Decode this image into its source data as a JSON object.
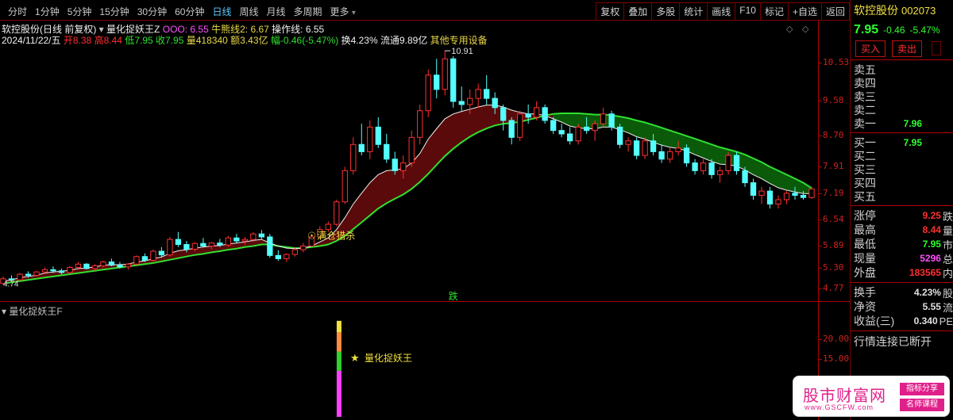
{
  "toolbar": {
    "periods": [
      "分时",
      "1分钟",
      "5分钟",
      "15分钟",
      "30分钟",
      "60分钟",
      "日线",
      "周线",
      "月线",
      "多周期",
      "更多"
    ],
    "active_period": "日线",
    "right_buttons": [
      "复权",
      "叠加",
      "多股",
      "统计",
      "画线",
      "F10",
      "标记",
      "+自选",
      "返回"
    ]
  },
  "chart_info": {
    "title": "软控股份(日线 前复权)",
    "indicator_name": "量化捉妖王Z",
    "ooo_label": "OOO: 6.55",
    "niubai_label": "牛熊线2: 6.67",
    "caozuo_label": "操作线: 6.55",
    "date": "2024/11/22/五",
    "open_label": "开",
    "open": "8.38",
    "high_label": "高",
    "high": "8.44",
    "low_label": "低",
    "low": "7.95",
    "close_label": "收",
    "close": "7.95",
    "vol_label": "量",
    "vol": "418340",
    "amount_label": "额",
    "amount": "3.43亿",
    "range_label": "幅",
    "range": "-0.46(-5.47%)",
    "turnover": "换4.23%",
    "circulation": "流通9.89亿",
    "other": "其他专用设备"
  },
  "y_axis_main": [
    "10.53",
    "9.58",
    "8.70",
    "7.91",
    "7.19",
    "6.54",
    "5.89",
    "5.30",
    "4.77"
  ],
  "y_axis_sub": [
    "20.00",
    "15.00"
  ],
  "annotations": {
    "peak": "10.91",
    "bottom_left": "4.74",
    "signal": "满仓猎杀",
    "die": "跌",
    "sub_signal": "量化捉妖王"
  },
  "sub_title": "量化捉妖王F",
  "chart_data": {
    "type": "candlestick",
    "x_range": [
      0,
      170
    ],
    "y_range": [
      4.5,
      11.1
    ],
    "candles_ohlc": [
      [
        4.74,
        4.86,
        4.72,
        4.82
      ],
      [
        4.82,
        4.88,
        4.78,
        4.8
      ],
      [
        4.8,
        4.92,
        4.78,
        4.9
      ],
      [
        4.9,
        4.95,
        4.84,
        4.88
      ],
      [
        4.88,
        4.96,
        4.86,
        4.94
      ],
      [
        4.94,
        5.02,
        4.9,
        4.98
      ],
      [
        4.98,
        5.04,
        4.92,
        4.96
      ],
      [
        4.96,
        5.0,
        4.9,
        4.93
      ],
      [
        4.93,
        5.05,
        4.91,
        5.02
      ],
      [
        5.02,
        5.12,
        5.0,
        5.08
      ],
      [
        5.08,
        5.1,
        4.98,
        5.0
      ],
      [
        5.0,
        5.08,
        4.96,
        5.05
      ],
      [
        5.05,
        5.14,
        5.02,
        5.12
      ],
      [
        5.12,
        5.18,
        5.04,
        5.06
      ],
      [
        5.06,
        5.12,
        5.0,
        5.03
      ],
      [
        5.03,
        5.1,
        4.98,
        5.08
      ],
      [
        5.08,
        5.24,
        5.06,
        5.22
      ],
      [
        5.22,
        5.28,
        5.12,
        5.15
      ],
      [
        5.15,
        5.35,
        5.13,
        5.32
      ],
      [
        5.32,
        5.4,
        5.2,
        5.25
      ],
      [
        5.25,
        5.6,
        5.22,
        5.55
      ],
      [
        5.55,
        5.7,
        5.4,
        5.45
      ],
      [
        5.45,
        5.52,
        5.3,
        5.36
      ],
      [
        5.36,
        5.5,
        5.32,
        5.47
      ],
      [
        5.47,
        5.58,
        5.4,
        5.42
      ],
      [
        5.42,
        5.5,
        5.36,
        5.48
      ],
      [
        5.48,
        5.56,
        5.4,
        5.44
      ],
      [
        5.44,
        5.62,
        5.4,
        5.58
      ],
      [
        5.58,
        5.66,
        5.48,
        5.52
      ],
      [
        5.52,
        5.6,
        5.44,
        5.55
      ],
      [
        5.55,
        5.7,
        5.5,
        5.66
      ],
      [
        5.66,
        5.74,
        5.55,
        5.6
      ],
      [
        5.6,
        5.66,
        5.2,
        5.24
      ],
      [
        5.24,
        5.34,
        5.14,
        5.18
      ],
      [
        5.18,
        5.28,
        5.12,
        5.26
      ],
      [
        5.26,
        5.4,
        5.22,
        5.35
      ],
      [
        5.35,
        5.48,
        5.3,
        5.42
      ],
      [
        5.42,
        5.66,
        5.4,
        5.6
      ],
      [
        5.6,
        5.82,
        5.56,
        5.75
      ],
      [
        5.75,
        5.92,
        5.7,
        5.86
      ],
      [
        5.86,
        6.4,
        5.82,
        6.35
      ],
      [
        6.35,
        7.2,
        6.3,
        7.1
      ],
      [
        7.1,
        8.0,
        7.0,
        7.8
      ],
      [
        7.8,
        8.4,
        7.5,
        7.6
      ],
      [
        7.6,
        8.5,
        7.4,
        8.3
      ],
      [
        8.3,
        8.6,
        7.7,
        7.8
      ],
      [
        7.8,
        8.1,
        7.3,
        7.4
      ],
      [
        7.4,
        7.6,
        7.0,
        7.1
      ],
      [
        7.1,
        7.5,
        6.9,
        7.3
      ],
      [
        7.3,
        8.2,
        7.2,
        8.0
      ],
      [
        8.0,
        9.0,
        7.8,
        8.8
      ],
      [
        8.8,
        10.2,
        8.6,
        10.0
      ],
      [
        10.0,
        10.6,
        9.2,
        9.5
      ],
      [
        9.5,
        10.91,
        9.3,
        10.6
      ],
      [
        10.6,
        10.7,
        8.9,
        9.1
      ],
      [
        9.1,
        9.6,
        8.8,
        9.0
      ],
      [
        9.0,
        9.5,
        8.7,
        9.2
      ],
      [
        9.2,
        9.7,
        8.9,
        9.5
      ],
      [
        9.5,
        10.0,
        9.0,
        9.2
      ],
      [
        9.2,
        9.4,
        8.7,
        8.9
      ],
      [
        8.9,
        9.0,
        8.2,
        8.5
      ],
      [
        8.5,
        8.6,
        7.8,
        8.0
      ],
      [
        8.0,
        8.8,
        7.9,
        8.7
      ],
      [
        8.7,
        9.0,
        8.4,
        8.6
      ],
      [
        8.6,
        9.1,
        8.5,
        8.9
      ],
      [
        8.9,
        9.0,
        8.4,
        8.5
      ],
      [
        8.5,
        8.6,
        8.1,
        8.2
      ],
      [
        8.2,
        8.4,
        8.0,
        8.1
      ],
      [
        8.1,
        8.3,
        7.8,
        7.9
      ],
      [
        7.9,
        8.4,
        7.8,
        8.3
      ],
      [
        8.3,
        8.6,
        8.1,
        8.2
      ],
      [
        8.2,
        8.5,
        7.9,
        8.4
      ],
      [
        8.4,
        8.9,
        8.3,
        8.7
      ],
      [
        8.7,
        8.8,
        8.2,
        8.3
      ],
      [
        8.3,
        8.4,
        7.7,
        7.8
      ],
      [
        7.8,
        8.0,
        7.6,
        7.9
      ],
      [
        7.9,
        8.0,
        7.4,
        7.5
      ],
      [
        7.5,
        8.0,
        7.4,
        7.9
      ],
      [
        7.9,
        8.1,
        7.5,
        7.6
      ],
      [
        7.6,
        7.8,
        7.3,
        7.4
      ],
      [
        7.4,
        7.7,
        7.3,
        7.6
      ],
      [
        7.6,
        7.9,
        7.5,
        7.7
      ],
      [
        7.7,
        7.8,
        7.2,
        7.3
      ],
      [
        7.3,
        7.4,
        7.0,
        7.1
      ],
      [
        7.1,
        7.4,
        7.0,
        7.3
      ],
      [
        7.3,
        7.4,
        6.9,
        7.0
      ],
      [
        7.0,
        7.2,
        6.8,
        7.1
      ],
      [
        7.1,
        7.6,
        7.0,
        7.5
      ],
      [
        7.5,
        7.6,
        7.0,
        7.1
      ],
      [
        7.1,
        7.2,
        6.7,
        6.8
      ],
      [
        6.8,
        6.9,
        6.4,
        6.5
      ],
      [
        6.5,
        6.7,
        6.3,
        6.6
      ],
      [
        6.6,
        6.7,
        6.2,
        6.3
      ],
      [
        6.3,
        6.5,
        6.2,
        6.4
      ],
      [
        6.4,
        6.6,
        6.3,
        6.55
      ],
      [
        6.55,
        6.7,
        6.4,
        6.5
      ],
      [
        6.5,
        6.6,
        6.4,
        6.45
      ],
      [
        6.45,
        6.7,
        6.42,
        6.65
      ]
    ],
    "ma_white": [
      4.78,
      4.8,
      4.84,
      4.86,
      4.88,
      4.92,
      4.94,
      4.95,
      4.97,
      5.0,
      5.01,
      5.03,
      5.06,
      5.07,
      5.07,
      5.08,
      5.12,
      5.14,
      5.18,
      5.21,
      5.28,
      5.33,
      5.35,
      5.38,
      5.4,
      5.42,
      5.43,
      5.46,
      5.48,
      5.5,
      5.53,
      5.55,
      5.48,
      5.42,
      5.38,
      5.37,
      5.38,
      5.42,
      5.5,
      5.58,
      5.75,
      6.0,
      6.3,
      6.55,
      6.8,
      7.0,
      7.1,
      7.12,
      7.15,
      7.3,
      7.55,
      7.95,
      8.25,
      8.55,
      8.7,
      8.78,
      8.85,
      8.92,
      8.98,
      8.98,
      8.92,
      8.82,
      8.75,
      8.7,
      8.7,
      8.65,
      8.55,
      8.45,
      8.33,
      8.28,
      8.25,
      8.25,
      8.3,
      8.3,
      8.22,
      8.13,
      8.02,
      7.95,
      7.86,
      7.78,
      7.72,
      7.69,
      7.62,
      7.52,
      7.43,
      7.34,
      7.27,
      7.25,
      7.22,
      7.12,
      7.0,
      6.9,
      6.78,
      6.68,
      6.62,
      6.58,
      6.54,
      6.54
    ],
    "ma_green": [
      4.74,
      4.76,
      4.78,
      4.8,
      4.82,
      4.84,
      4.86,
      4.88,
      4.9,
      4.92,
      4.94,
      4.96,
      4.98,
      5.0,
      5.02,
      5.04,
      5.06,
      5.08,
      5.1,
      5.13,
      5.16,
      5.19,
      5.22,
      5.25,
      5.27,
      5.3,
      5.32,
      5.35,
      5.37,
      5.4,
      5.42,
      5.45,
      5.45,
      5.42,
      5.4,
      5.38,
      5.38,
      5.4,
      5.42,
      5.45,
      5.52,
      5.62,
      5.76,
      5.9,
      6.05,
      6.2,
      6.32,
      6.42,
      6.52,
      6.65,
      6.82,
      7.02,
      7.25,
      7.48,
      7.68,
      7.86,
      8.02,
      8.15,
      8.26,
      8.35,
      8.4,
      8.42,
      8.46,
      8.52,
      8.58,
      8.65,
      8.7,
      8.72,
      8.72,
      8.72,
      8.7,
      8.68,
      8.68,
      8.66,
      8.62,
      8.57,
      8.5,
      8.44,
      8.36,
      8.28,
      8.2,
      8.12,
      8.04,
      7.96,
      7.88,
      7.8,
      7.72,
      7.66,
      7.6,
      7.52,
      7.42,
      7.32,
      7.2,
      7.1,
      7.0,
      6.9,
      6.8,
      6.67
    ],
    "sub_bar": {
      "index": 40,
      "segments": [
        {
          "from": 0,
          "to": 24,
          "color": "#ff40ff"
        },
        {
          "from": 24,
          "to": 34,
          "color": "#30d030"
        },
        {
          "from": 34,
          "to": 44,
          "color": "#ff8c40"
        },
        {
          "from": 44,
          "to": 50,
          "color": "#f0e040"
        }
      ]
    },
    "sub_y_range": [
      10,
      26
    ]
  },
  "panel": {
    "name": "软控股份",
    "code": "002073",
    "price": "7.95",
    "change": "-0.46",
    "change_pct": "-5.47%",
    "buy_btn": "买入",
    "sell_btn": "卖出",
    "asks": [
      {
        "label": "卖五",
        "price": ""
      },
      {
        "label": "卖四",
        "price": ""
      },
      {
        "label": "卖三",
        "price": ""
      },
      {
        "label": "卖二",
        "price": ""
      },
      {
        "label": "卖一",
        "price": "7.96"
      }
    ],
    "bids": [
      {
        "label": "买一",
        "price": "7.95"
      },
      {
        "label": "买二",
        "price": ""
      },
      {
        "label": "买三",
        "price": ""
      },
      {
        "label": "买四",
        "price": ""
      },
      {
        "label": "买五",
        "price": ""
      }
    ],
    "stats": [
      {
        "label": "涨停",
        "value": "9.25",
        "color": "#ff3030",
        "extra": "跌"
      },
      {
        "label": "最高",
        "value": "8.44",
        "color": "#ff3030",
        "extra": "量"
      },
      {
        "label": "最低",
        "value": "7.95",
        "color": "#30ff30",
        "extra": "市"
      },
      {
        "label": "现量",
        "value": "5296",
        "color": "#ff50ff",
        "extra": "总"
      },
      {
        "label": "外盘",
        "value": "183565",
        "color": "#ff3030",
        "extra": "内"
      }
    ],
    "stats2": [
      {
        "label": "换手",
        "value": "4.23%",
        "color": "#e0e0e0",
        "extra": "股"
      },
      {
        "label": "净资",
        "value": "5.55",
        "color": "#e0e0e0",
        "extra": "流"
      },
      {
        "label": "收益(三)",
        "value": "0.340",
        "color": "#e0e0e0",
        "extra": "PE"
      }
    ],
    "status": "行情连接已断开"
  },
  "watermark": {
    "title": "股市财富网",
    "url": "www.GSCFW.com",
    "tag1": "指标分享",
    "tag2": "名师课程"
  }
}
